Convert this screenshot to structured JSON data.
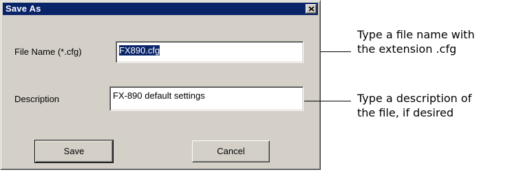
{
  "dialog": {
    "title": "Save As",
    "close_icon": "close-x-icon",
    "title_bar_color": "#0a246a",
    "fields": {
      "file_name": {
        "label": "File Name (*.cfg)",
        "value": "FX890.cfg",
        "selected": true
      },
      "description": {
        "label": "Description",
        "value": "FX-890 default settings"
      }
    },
    "buttons": {
      "save": "Save",
      "cancel": "Cancel"
    }
  },
  "callouts": {
    "file_name": {
      "line1": "Type a file name with",
      "line2": "the extension .cfg"
    },
    "description": {
      "line1": "Type a description of",
      "line2": "the file, if desired"
    }
  }
}
